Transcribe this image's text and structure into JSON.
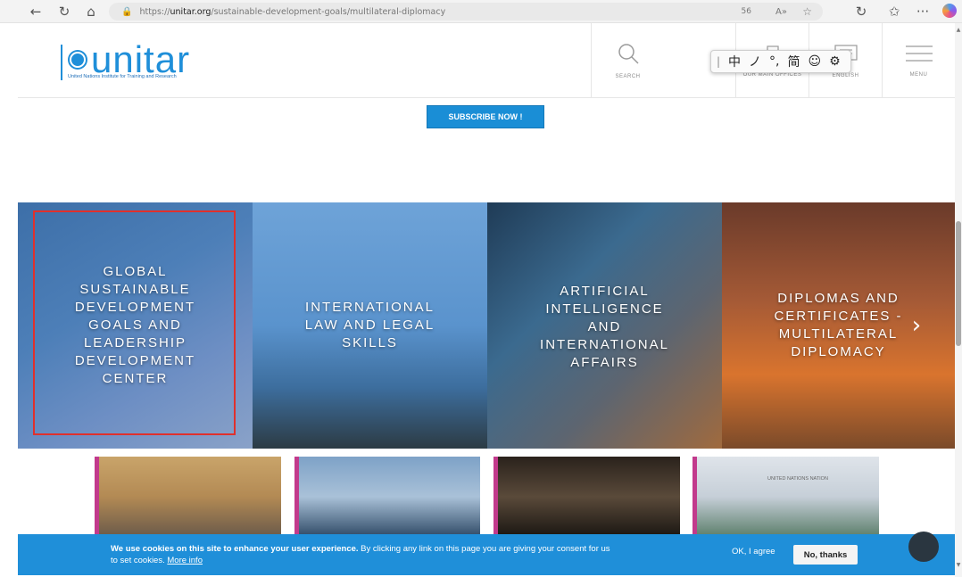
{
  "browser": {
    "url_prefix": "https://",
    "url_domain": "unitar.org",
    "url_path": "/sustainable-development-goals/multilateral-diplomacy",
    "zoom": "56"
  },
  "header": {
    "logo_text": "unitar",
    "logo_subtitle": "United Nations Institute for Training and Research",
    "search_label": "SEARCH",
    "offices_label": "OUR MAIN OFFICES",
    "language_label": "ENGLISH",
    "menu_label": "MENU"
  },
  "ime_toolbar": {
    "items": [
      "中",
      "ノ",
      "°,",
      "简",
      "☺",
      "⚙"
    ]
  },
  "subscribe_label": "SUBSCRIBE NOW !",
  "hero_tiles": [
    {
      "title": "GLOBAL\nSUSTAINABLE\nDEVELOPMENT\nGOALS AND\nLEADERSHIP\nDEVELOPMENT\nCENTER"
    },
    {
      "title": "INTERNATIONAL\nLAW AND LEGAL\nSKILLS"
    },
    {
      "title": "ARTIFICIAL\nINTELLIGENCE\nAND\nINTERNATIONAL\nAFFAIRS"
    },
    {
      "title": "DIPLOMAS AND\nCERTIFICATES -\nMULTILATERAL\nDIPLOMACY"
    }
  ],
  "thumb_labels": {
    "un_building_sign": "UNITED NATIONS  NATION"
  },
  "cookie": {
    "bold": "We use cookies on this site to enhance your user experience.",
    "rest": " By clicking any link on this page you are giving your consent for us to set cookies.",
    "more": "More info",
    "agree": "OK, I agree",
    "decline": "No, thanks"
  },
  "colors": {
    "brand": "#1f8fd9",
    "selection_outline": "#e0302c",
    "accent_pink": "#c23a8c"
  }
}
